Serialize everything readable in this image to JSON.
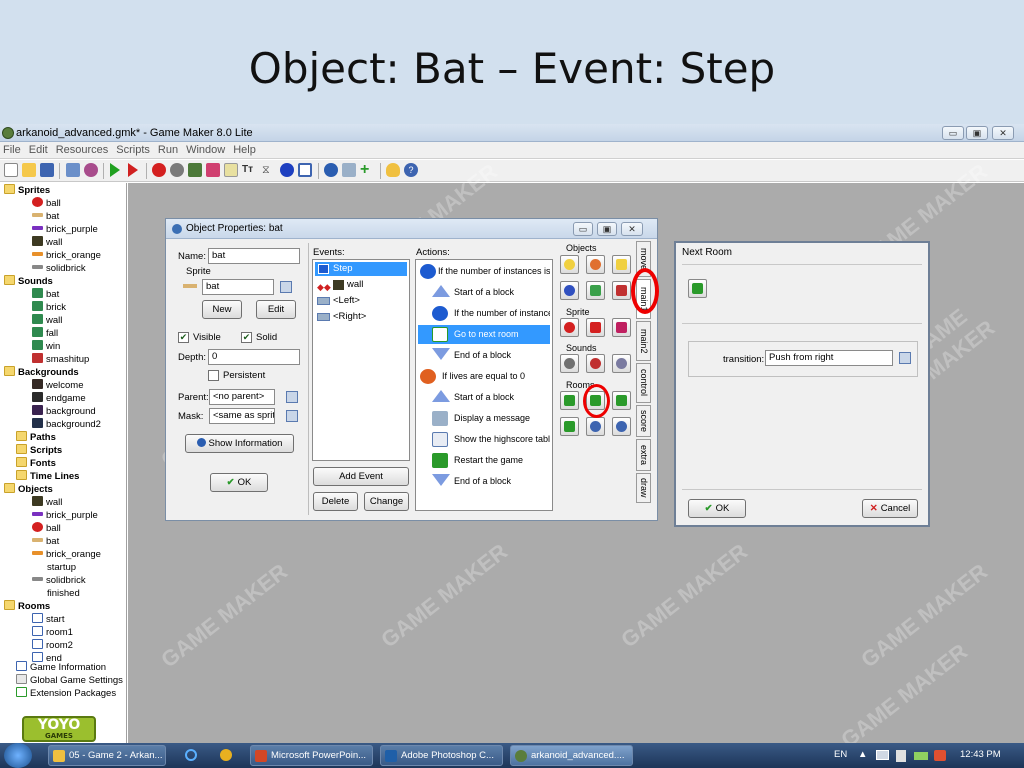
{
  "slide": {
    "title": "Object: Bat – Event: Step"
  },
  "app": {
    "title": "arkanoid_advanced.gmk* - Game Maker 8.0 Lite"
  },
  "menu": [
    "File",
    "Edit",
    "Resources",
    "Scripts",
    "Run",
    "Window",
    "Help"
  ],
  "tree": {
    "sprites_label": "Sprites",
    "sprites": [
      "ball",
      "bat",
      "brick_purple",
      "wall",
      "brick_orange",
      "solidbrick"
    ],
    "sounds_label": "Sounds",
    "sounds": [
      "bat",
      "brick",
      "wall",
      "fall",
      "win",
      "smashitup"
    ],
    "backgrounds_label": "Backgrounds",
    "backgrounds": [
      "welcome",
      "endgame",
      "background",
      "background2"
    ],
    "paths": "Paths",
    "scripts": "Scripts",
    "fonts": "Fonts",
    "timelines": "Time Lines",
    "objects_label": "Objects",
    "objects": [
      "wall",
      "brick_purple",
      "ball",
      "bat",
      "brick_orange",
      "startup",
      "solidbrick",
      "finished"
    ],
    "rooms_label": "Rooms",
    "rooms": [
      "start",
      "room1",
      "room2",
      "end"
    ],
    "game_information": "Game Information",
    "global_settings": "Global Game Settings",
    "extension_packages": "Extension Packages"
  },
  "logo": {
    "main": "YOYO",
    "sub": "GAMES"
  },
  "watermark": "GAME MAKER",
  "object_props": {
    "title": "Object Properties: bat",
    "name_label": "Name:",
    "name_value": "bat",
    "sprite_label": "Sprite",
    "sprite_value": "bat",
    "new_label": "New",
    "edit_label": "Edit",
    "visible_label": "Visible",
    "solid_label": "Solid",
    "depth_label": "Depth:",
    "depth_value": "0",
    "persistent_label": "Persistent",
    "parent_label": "Parent:",
    "parent_value": "<no parent>",
    "mask_label": "Mask:",
    "mask_value": "<same as sprite>",
    "show_info_label": "Show Information",
    "ok_label": "OK",
    "events_label": "Events:",
    "events": [
      "Step",
      "wall",
      "<Left>",
      "<Right>"
    ],
    "add_event_label": "Add Event",
    "delete_label": "Delete",
    "change_label": "Change",
    "actions_label": "Actions:",
    "actions": [
      "If the number of instances is",
      "Start of a block",
      "If the number of instances",
      "Go to next room",
      "End of a block",
      "If lives are equal to 0",
      "Start of a block",
      "Display a message",
      "Show the highscore table",
      "Restart the game",
      "End of a block"
    ],
    "palette_groups": {
      "objects": "Objects",
      "sprite": "Sprite",
      "sounds": "Sounds",
      "rooms": "Rooms"
    },
    "tabs": [
      "move",
      "main1",
      "main2",
      "control",
      "score",
      "extra",
      "draw"
    ]
  },
  "next_room": {
    "title": "Next Room",
    "transition_label": "transition:",
    "transition_value": "Push from right",
    "ok_label": "OK",
    "cancel_label": "Cancel"
  },
  "taskbar": {
    "items": [
      "05 - Game 2 - Arkan...",
      "Microsoft PowerPoin...",
      "Adobe Photoshop C...",
      "arkanoid_advanced...."
    ],
    "lang": "EN",
    "time": "12:43 PM"
  }
}
